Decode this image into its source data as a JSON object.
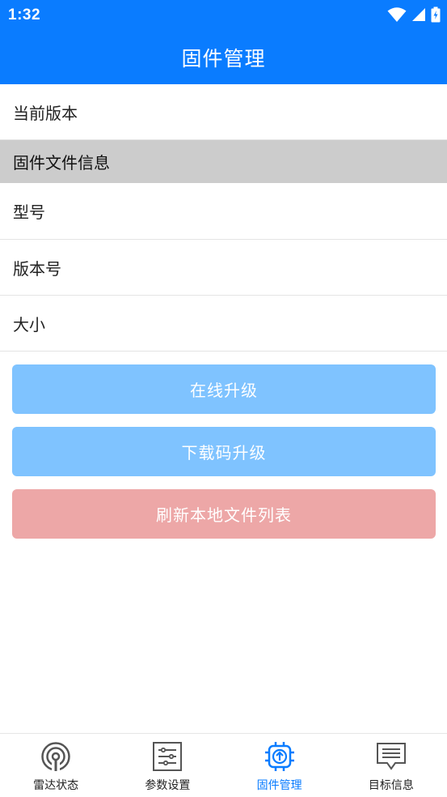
{
  "status_bar": {
    "time": "1:32",
    "icons": [
      "wifi-icon",
      "signal-icon",
      "battery-charging-icon"
    ]
  },
  "app_bar": {
    "title": "固件管理"
  },
  "list": {
    "current_version_label": "当前版本",
    "section_header": "固件文件信息",
    "model_label": "型号",
    "version_number_label": "版本号",
    "size_label": "大小"
  },
  "buttons": {
    "online_upgrade": "在线升级",
    "download_upgrade": "下载码升级",
    "refresh_list": "刷新本地文件列表"
  },
  "colors": {
    "primary": "#0A7CFF",
    "button_blue": "#7FC3FF",
    "button_red": "#EDA7A7",
    "section_bg": "#CCCCCC"
  },
  "bottom_nav": {
    "items": [
      {
        "label": "雷达状态",
        "icon": "radar-icon",
        "active": false
      },
      {
        "label": "参数设置",
        "icon": "sliders-icon",
        "active": false
      },
      {
        "label": "固件管理",
        "icon": "firmware-chip-icon",
        "active": true
      },
      {
        "label": "目标信息",
        "icon": "message-icon",
        "active": false
      }
    ]
  }
}
